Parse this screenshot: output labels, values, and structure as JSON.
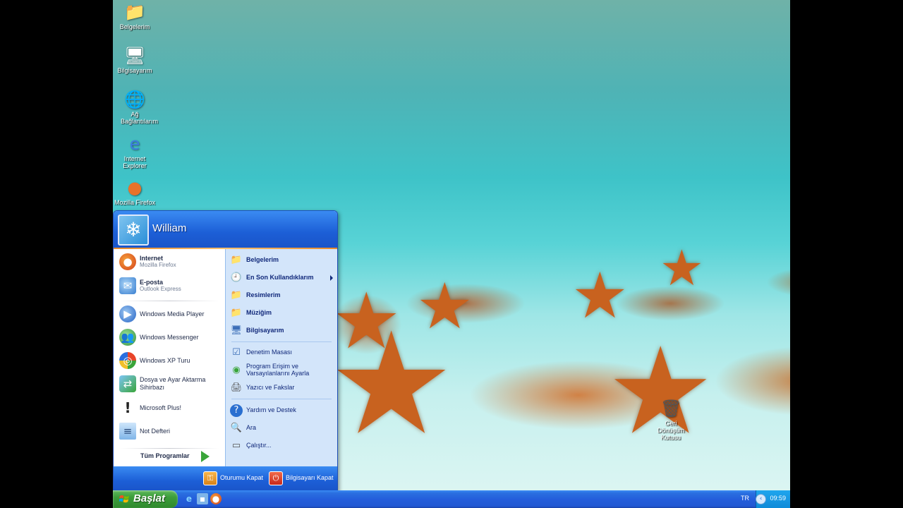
{
  "desktop": {
    "icons": [
      {
        "label": "Belgelerim",
        "icon": "my-documents-icon"
      },
      {
        "label": "Bilgisayarım",
        "icon": "my-computer-icon"
      },
      {
        "label": "Ağ Bağlantılarım",
        "icon": "network-icon"
      },
      {
        "label": "Internet Explorer",
        "icon": "ie-icon"
      },
      {
        "label": "Mozilla Firefox",
        "icon": "firefox-icon"
      },
      {
        "label": "Geri Dönüşüm Kutusu",
        "icon": "recycle-bin-icon"
      }
    ]
  },
  "start_menu": {
    "user_name": "William",
    "left_pinned": [
      {
        "title": "Internet",
        "subtitle": "Mozilla Firefox"
      },
      {
        "title": "E-posta",
        "subtitle": "Outlook Express"
      }
    ],
    "left_recent": [
      "Windows Media Player",
      "Windows Messenger",
      "Windows XP Turu",
      "Dosya ve Ayar Aktarma Sihirbazı",
      "Microsoft Plus!",
      "Not Defteri"
    ],
    "all_programs_label": "Tüm Programlar",
    "right_items": [
      "Belgelerim",
      "En Son Kullandıklarım",
      "Resimlerim",
      "Müziğim",
      "Bilgisayarım",
      "Denetim Masası",
      "Program Erişim ve Varsayılanlarını Ayarla",
      "Yazıcı ve Fakslar",
      "Yardım ve Destek",
      "Ara",
      "Çalıştır..."
    ],
    "logoff_label": "Oturumu Kapat",
    "shutdown_label": "Bilgisayarı Kapat"
  },
  "taskbar": {
    "start_label": "Başlat",
    "language": "TR",
    "clock": "09:59"
  }
}
